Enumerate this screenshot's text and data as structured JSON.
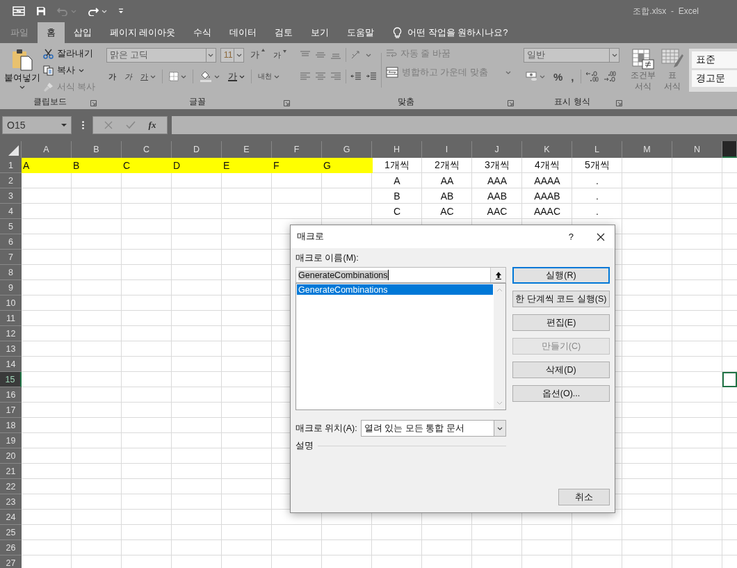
{
  "title_bar": {
    "title": "조합.xlsx  -  Excel",
    "quick_access": [
      {
        "kind": "touch",
        "disabled": false
      },
      {
        "kind": "save",
        "disabled": false
      },
      {
        "kind": "undo",
        "disabled": true
      },
      {
        "kind": "redo",
        "disabled": false
      },
      {
        "kind": "customize",
        "disabled": false
      }
    ]
  },
  "tabs": [
    {
      "label": "파일",
      "kind": "file",
      "selected": false
    },
    {
      "label": "홈",
      "kind": "tab",
      "selected": true
    },
    {
      "label": "삽입",
      "kind": "tab",
      "selected": false
    },
    {
      "label": "페이지 레이아웃",
      "kind": "tab",
      "selected": false
    },
    {
      "label": "수식",
      "kind": "tab",
      "selected": false
    },
    {
      "label": "데이터",
      "kind": "tab",
      "selected": false
    },
    {
      "label": "검토",
      "kind": "tab",
      "selected": false
    },
    {
      "label": "보기",
      "kind": "tab",
      "selected": false
    },
    {
      "label": "도움말",
      "kind": "tab",
      "selected": false
    }
  ],
  "tell_me": {
    "placeholder": "어떤 작업을 원하시나요?"
  },
  "ribbon": {
    "clipboard": {
      "label": "클립보드",
      "paste": "붙여넣기",
      "cut": {
        "label": "잘라내기",
        "disabled": false
      },
      "copy": {
        "label": "복사",
        "disabled": false
      },
      "format_painter": {
        "label": "서식 복사",
        "disabled": true
      }
    },
    "font": {
      "label": "글꼴",
      "font_name": "맑은 고딕",
      "font_size": "11",
      "grow": "가",
      "shrink": "가",
      "bold": "가",
      "italic": "가",
      "underline": "가",
      "font_color": "가",
      "phonetic": "내천"
    },
    "alignment": {
      "label": "맞춤",
      "wrap_text": {
        "label": "자동 줄 바꿈",
        "disabled": true
      },
      "merge": {
        "label": "병합하고 가운데 맞춤",
        "disabled": true
      }
    },
    "number": {
      "label": "표시 형식",
      "format": "일반",
      "percent": "%",
      "comma": ","
    },
    "styles": {
      "conditional_formatting": [
        "조건부",
        "서식"
      ],
      "format_as_table": [
        "표",
        "서식"
      ],
      "cell_styles": [
        "표준",
        "경고문"
      ]
    }
  },
  "formula_bar": {
    "name_box": "O15",
    "fx": "fx"
  },
  "sheet": {
    "columns": [
      {
        "label": "A",
        "selected": false
      },
      {
        "label": "B",
        "selected": false
      },
      {
        "label": "C",
        "selected": false
      },
      {
        "label": "D",
        "selected": false
      },
      {
        "label": "E",
        "selected": false
      },
      {
        "label": "F",
        "selected": false
      },
      {
        "label": "G",
        "selected": false
      },
      {
        "label": "H",
        "selected": false
      },
      {
        "label": "I",
        "selected": false
      },
      {
        "label": "J",
        "selected": false
      },
      {
        "label": "K",
        "selected": false
      },
      {
        "label": "L",
        "selected": false
      },
      {
        "label": "M",
        "selected": false
      },
      {
        "label": "N",
        "selected": false
      },
      {
        "selected": true
      }
    ],
    "rows": [
      {
        "label": "1",
        "selected": false,
        "cells": [
          {
            "text": "A",
            "highlighted": true,
            "centered": false
          },
          {
            "text": "B",
            "highlighted": true,
            "centered": false
          },
          {
            "text": "C",
            "highlighted": true,
            "centered": false
          },
          {
            "text": "D",
            "highlighted": true,
            "centered": false
          },
          {
            "text": "E",
            "highlighted": true,
            "centered": false
          },
          {
            "text": "F",
            "highlighted": true,
            "centered": false
          },
          {
            "text": "G",
            "highlighted": true,
            "centered": false
          },
          {
            "text": "1개씩",
            "highlighted": false,
            "centered": true
          },
          {
            "text": "2개씩",
            "highlighted": false,
            "centered": true
          },
          {
            "text": "3개씩",
            "highlighted": false,
            "centered": true
          },
          {
            "text": "4개씩",
            "highlighted": false,
            "centered": true
          },
          {
            "text": "5개씩",
            "highlighted": false,
            "centered": true
          }
        ]
      },
      {
        "label": "2",
        "selected": false,
        "cells": [
          {},
          {},
          {},
          {},
          {},
          {},
          {},
          {
            "text": "A",
            "highlighted": false,
            "centered": true
          },
          {
            "text": "AA",
            "highlighted": false,
            "centered": true
          },
          {
            "text": "AAA",
            "highlighted": false,
            "centered": true
          },
          {
            "text": "AAAA",
            "highlighted": false,
            "centered": true
          },
          {
            "text": ".",
            "highlighted": false,
            "centered": true
          }
        ]
      },
      {
        "label": "3",
        "selected": false,
        "cells": [
          {},
          {},
          {},
          {},
          {},
          {},
          {},
          {
            "text": "B",
            "highlighted": false,
            "centered": true
          },
          {
            "text": "AB",
            "highlighted": false,
            "centered": true
          },
          {
            "text": "AAB",
            "highlighted": false,
            "centered": true
          },
          {
            "text": "AAAB",
            "highlighted": false,
            "centered": true
          },
          {
            "text": ".",
            "highlighted": false,
            "centered": true
          }
        ]
      },
      {
        "label": "4",
        "selected": false,
        "cells": [
          {},
          {},
          {},
          {},
          {},
          {},
          {},
          {
            "text": "C",
            "highlighted": false,
            "centered": true
          },
          {
            "text": "AC",
            "highlighted": false,
            "centered": true
          },
          {
            "text": "AAC",
            "highlighted": false,
            "centered": true
          },
          {
            "text": "AAAC",
            "highlighted": false,
            "centered": true
          },
          {
            "text": ".",
            "highlighted": false,
            "centered": true
          }
        ]
      },
      {
        "label": "5",
        "selected": false
      },
      {
        "label": "6",
        "selected": false
      },
      {
        "label": "7",
        "selected": false
      },
      {
        "label": "8",
        "selected": false
      },
      {
        "label": "9",
        "selected": false
      },
      {
        "label": "10",
        "selected": false
      },
      {
        "label": "11",
        "selected": false
      },
      {
        "label": "12",
        "selected": false
      },
      {
        "label": "13",
        "selected": false
      },
      {
        "label": "14",
        "selected": false
      },
      {
        "label": "15",
        "selected": true
      },
      {
        "label": "16",
        "selected": false
      },
      {
        "label": "17",
        "selected": false
      },
      {
        "label": "18",
        "selected": false
      },
      {
        "label": "19",
        "selected": false
      },
      {
        "label": "20",
        "selected": false
      },
      {
        "label": "21",
        "selected": false
      },
      {
        "label": "22",
        "selected": false
      },
      {
        "label": "23",
        "selected": false
      },
      {
        "label": "24",
        "selected": false
      },
      {
        "label": "25",
        "selected": false
      },
      {
        "label": "26",
        "selected": false
      },
      {
        "label": "27",
        "selected": false
      }
    ]
  },
  "dialog": {
    "title": "매크로",
    "help": "?",
    "name_label": "매크로 이름(M):",
    "name_value": "GenerateCombinations",
    "value_selected": true,
    "macros": [
      {
        "name": "GenerateCombinations",
        "selected": true
      }
    ],
    "buttons": [
      {
        "label": "실행(R)",
        "default": true,
        "disabled": false
      },
      {
        "label": "한 단계씩 코드 실행(S)",
        "default": false,
        "disabled": false
      },
      {
        "label": "편집(E)",
        "default": false,
        "disabled": false
      },
      {
        "label": "만들기(C)",
        "default": false,
        "disabled": true
      },
      {
        "label": "삭제(D)",
        "default": false,
        "disabled": false
      },
      {
        "label": "옵션(O)...",
        "default": false,
        "disabled": false
      }
    ],
    "location_label": "매크로 위치(A):",
    "location_value": "열려 있는 모든 통합 문서",
    "description_label": "설명",
    "cancel": "취소"
  }
}
